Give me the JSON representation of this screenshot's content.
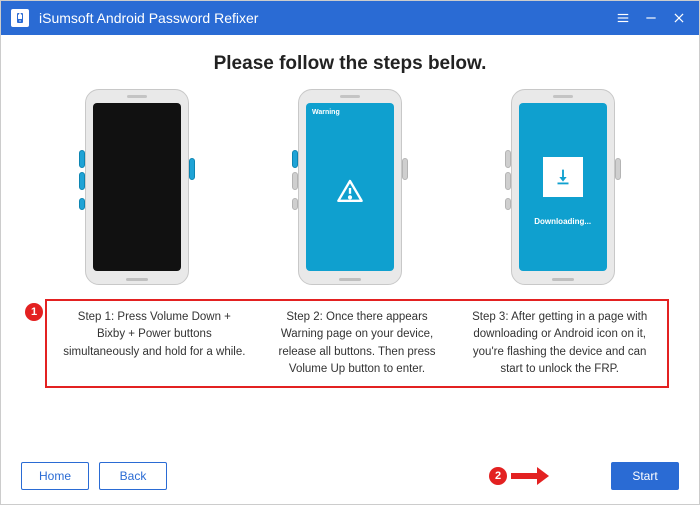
{
  "titlebar": {
    "title": "iSumsoft Android Password Refixer"
  },
  "headline": "Please follow the steps below.",
  "phones": {
    "p2_warning_label": "Warning",
    "p3_downloading_label": "Downloading..."
  },
  "instructions": {
    "step1": "Step 1: Press Volume Down + Bixby + Power buttons simultaneously and hold for a while.",
    "step2": "Step 2: Once there appears Warning page on your device, release all buttons. Then press Volume Up button to enter.",
    "step3": "Step 3: After getting in a page with downloading or Android icon on it, you're flashing the device and can start to unlock the FRP."
  },
  "annotations": {
    "badge1": "1",
    "badge2": "2"
  },
  "footer": {
    "home": "Home",
    "back": "Back",
    "start": "Start"
  }
}
